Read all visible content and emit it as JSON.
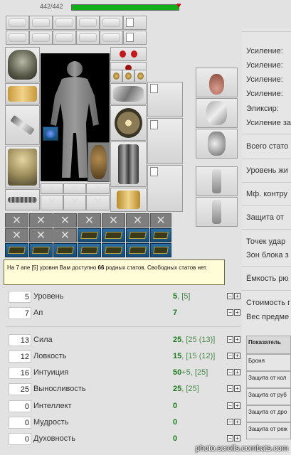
{
  "hp": {
    "text": "442/442",
    "current": 442,
    "max": 442
  },
  "tooltip": {
    "prefix": "На 7 апе [5] уровня Вам доступно ",
    "bold": "66",
    "suffix": " родных статов. Свободных статов нет."
  },
  "stats_top": [
    {
      "box": "5",
      "name": "Уровень",
      "val": "5",
      "tail": ", [5]"
    },
    {
      "box": "7",
      "name": "Ап",
      "val": "7",
      "tail": ""
    }
  ],
  "stats": [
    {
      "box": "13",
      "name": "Сила",
      "val": "25",
      "tail": ", [25 (13)]"
    },
    {
      "box": "12",
      "name": "Ловкость",
      "val": "15",
      "tail": ", [15 (12)]"
    },
    {
      "box": "16",
      "name": "Интуиция",
      "val": "50",
      "tail": "+5, [25]"
    },
    {
      "box": "25",
      "name": "Выносливость",
      "val": "25",
      "tail": ", [25]"
    },
    {
      "box": "0",
      "name": "Интеллект",
      "val": "0",
      "tail": ""
    },
    {
      "box": "0",
      "name": "Мудрость",
      "val": "0",
      "tail": ""
    },
    {
      "box": "0",
      "name": "Духовность",
      "val": "0",
      "tail": ""
    }
  ],
  "right_labels": [
    "Усиление:",
    "Усиление:",
    "Усиление:",
    "Усиление:",
    "Эликсир:",
    "Усиление за",
    "Всего стато",
    "Уровень жи",
    "Мф. контру",
    "Защита от",
    "Точек удар",
    "Зон блока з",
    "Ёмкость рю",
    "Стоимость г",
    "Вес предме"
  ],
  "table": {
    "header": "Показатель",
    "rows": [
      "Броня",
      "Защита от кол",
      "Защита от руб",
      "Защита от дро",
      "Защита от реж"
    ]
  },
  "watermark": "photo.scrolls.combats.com",
  "icons": {
    "helmet": "helmet-icon",
    "gloves": "gloves-icon",
    "sword": "sword-icon",
    "armor": "armor-icon",
    "belt": "belt-icon",
    "shield": "shield-icon",
    "legs": "leg-armor-icon",
    "boots": "boots-icon",
    "potion": "potion-icon",
    "pet": "pet-icon"
  }
}
